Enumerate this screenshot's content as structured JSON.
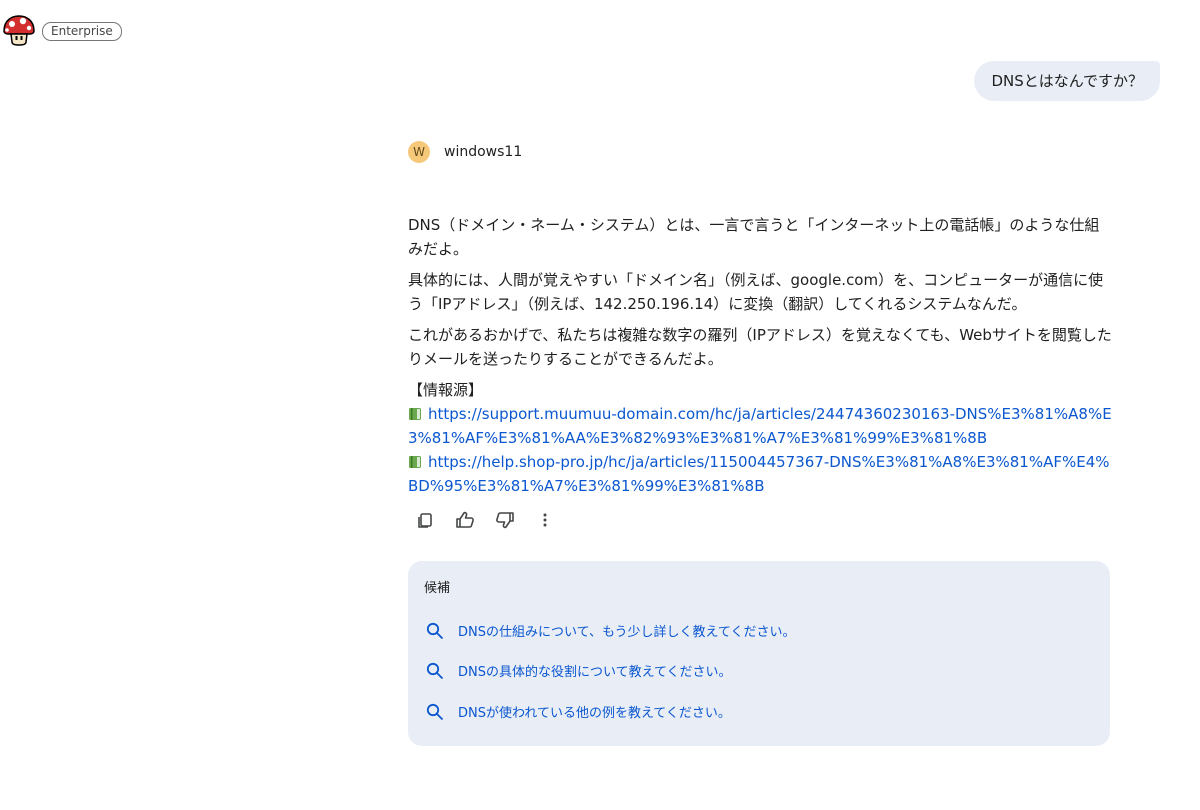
{
  "header": {
    "badge": "Enterprise"
  },
  "user_message": "DNSとはなんですか？",
  "agent": {
    "avatar_letter": "W",
    "name": "windows11"
  },
  "response": {
    "paragraphs": [
      "DNS（ドメイン・ネーム・システム）とは、一言で言うと「インターネット上の電話帳」のような仕組みだよ。",
      "具体的には、人間が覚えやすい「ドメイン名」（例えば、google.com）を、コンピューターが通信に使う「IPアドレス」（例えば、142.250.196.14）に変換（翻訳）してくれるシステムなんだ。",
      "これがあるおかげで、私たちは複雑な数字の羅列（IPアドレス）を覚えなくても、Webサイトを閲覧したりメールを送ったりすることができるんだよ。"
    ],
    "sources_label": "【情報源】",
    "sources": [
      "https://support.muumuu-domain.com/hc/ja/articles/24474360230163-DNS%E3%81%A8%E3%81%AF%E3%81%AA%E3%82%93%E3%81%A7%E3%81%99%E3%81%8B",
      "https://help.shop-pro.jp/hc/ja/articles/115004457367-DNS%E3%81%A8%E3%81%AF%E4%BD%95%E3%81%A7%E3%81%99%E3%81%8B"
    ]
  },
  "actions": {
    "icons": [
      "copy-icon",
      "thumbs-up-icon",
      "thumbs-down-icon",
      "more-vert-icon"
    ]
  },
  "suggestions": {
    "title": "候補",
    "items": [
      "DNSの仕組みについて、もう少し詳しく教えてください。",
      "DNSの具体的な役割について教えてください。",
      "DNSが使われている他の例を教えてください。"
    ]
  },
  "colors": {
    "link": "#0b57d0",
    "bubble": "#e9eef6",
    "avatar": "#f6c87a"
  }
}
